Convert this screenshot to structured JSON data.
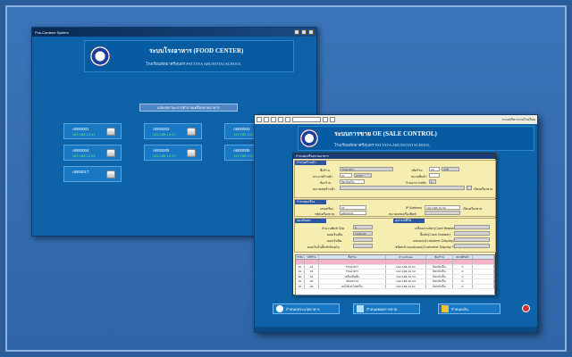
{
  "food_window": {
    "title": "Pos-Canteen System",
    "title_small": "ระบบบริหารงานโรงเรียน",
    "header_title": "ระบบโรงอาหาร (FOOD CENTER)",
    "header_sub": "โรงเรียนพัทยาศรีสุนทร  PATTAYA ARUNOTAI SCHOOL",
    "section_label": "แสดงสถานะการทำงานเครื่องขายอาหาร",
    "tiles": [
      {
        "name": "AB00001",
        "value": "192.168.10.51"
      },
      {
        "name": "AB00002",
        "value": "192.168.10.52"
      },
      {
        "name": "AB00003",
        "value": "192.168.10.53"
      },
      {
        "name": "AB00004",
        "value": "192.168.10.54"
      },
      {
        "name": "AB00005",
        "value": "192.168.10.55"
      },
      {
        "name": "AB00006",
        "value": "192.168.10.56"
      },
      {
        "name": "AB00017",
        "value": ""
      }
    ]
  },
  "sale_window": {
    "title_small": "ระบบบริหารงานโรงเรียน",
    "header_title": "ระบบการขาย OE (SALE CONTROL)",
    "header_sub": "โรงเรียนพัทยาศรีสุนทร  PATTAYA ARUNOTAI SCHOOL",
    "dialog": {
      "title": "กำหนดเครื่องขายอาหาร",
      "sec_store": "กำหนดร้านค้า",
      "sec_pos": "กำหนดเครื่อง",
      "sec_cash": "จองเงินสด",
      "sec_device": "อุปกรณ์ที่ใช้",
      "labels": {
        "name": "ชื่อร้าน",
        "shop_type": "ประเภทร้านค้า",
        "zone": "ห้องร้าน",
        "desc": "หมายเหตุร้านค้า",
        "code": "รหัสร้าน",
        "status": "สถานะ",
        "customer": "หมวดสินค้า",
        "level": "ร้านอาหารหลัก",
        "pos_no": "เลขเครื่อง",
        "ip": "IP Address",
        "pos_code": "รหัสเครื่องขาย",
        "pos_prefix": "หมายเลขเครื่องพิมพ์",
        "slip": "จำนวนพิมพ์ Slip",
        "cash_in": "ยอดเงินเปิด",
        "cash_out": "ยอดเงินปิด",
        "cash_total": "ยอดเงินในลิ้นชักปัจจุบัน",
        "card_reader": "เครื่องอ่านบัตร(Card Reader)",
        "cash_drawer": "ลิ้นชัก(Cash Drawer)",
        "display": "แสดงผล(Customer Display)",
        "display_type": "ชนิดหน้าจอแสดงผล(Customer Display Type)",
        "active": "เปิดเครื่องขาย",
        "open": "เปิดเครื่องขาย"
      },
      "values": {
        "name": "ร้านอาหาร",
        "shop_type": "01",
        "shop_type_name": "อาหาร",
        "zone": "ปิดกลับเป็น",
        "code": "20",
        "status": "ปกติ",
        "customer": "0",
        "pos_no": "21",
        "ip": "192.168.10.50",
        "pos_code": "AB00001",
        "slip": "0",
        "cash_in": "1040.00"
      },
      "grid_headers": [
        "ลำดับ",
        "รหัสร้าน",
        "ชื่อร้าน",
        "IP Address",
        "ห้องร้าน",
        "หมวดสินค้า",
        ""
      ],
      "grid_rows": [
        [
          "",
          "",
          "",
          "",
          "",
          "",
          ""
        ],
        [
          "20",
          "02",
          "ร้านอาหาร",
          "192.168.10.51",
          "ปิดกลับเป็น",
          "0",
          ""
        ],
        [
          "20",
          "03",
          "ร้านอาหาร",
          "192.168.10.52",
          "ปิดกลับเป็น",
          "0",
          ""
        ],
        [
          "60",
          "04",
          "เครื่องดื่มเย็น",
          "192.168.10.53",
          "ปิดกลับเป็น",
          "0",
          ""
        ],
        [
          "20",
          "05",
          "ขนมหวาน",
          "192.168.10.54",
          "ปิดกลับเป็น",
          "0",
          ""
        ],
        [
          "20",
          "06",
          "ผลไม้และไอศกรีม",
          "192.168.10.61",
          "ปิดกลับเป็น",
          "0",
          ""
        ]
      ]
    },
    "buttons": {
      "b1": "กำหนดประเภทอาหาร",
      "b2": "กำหนดยอดการขาย",
      "b3": "กำหนดเงิน"
    }
  },
  "colors": {
    "accent": "#0e63a8",
    "ok": "#65f06d",
    "close": "#d03030"
  }
}
